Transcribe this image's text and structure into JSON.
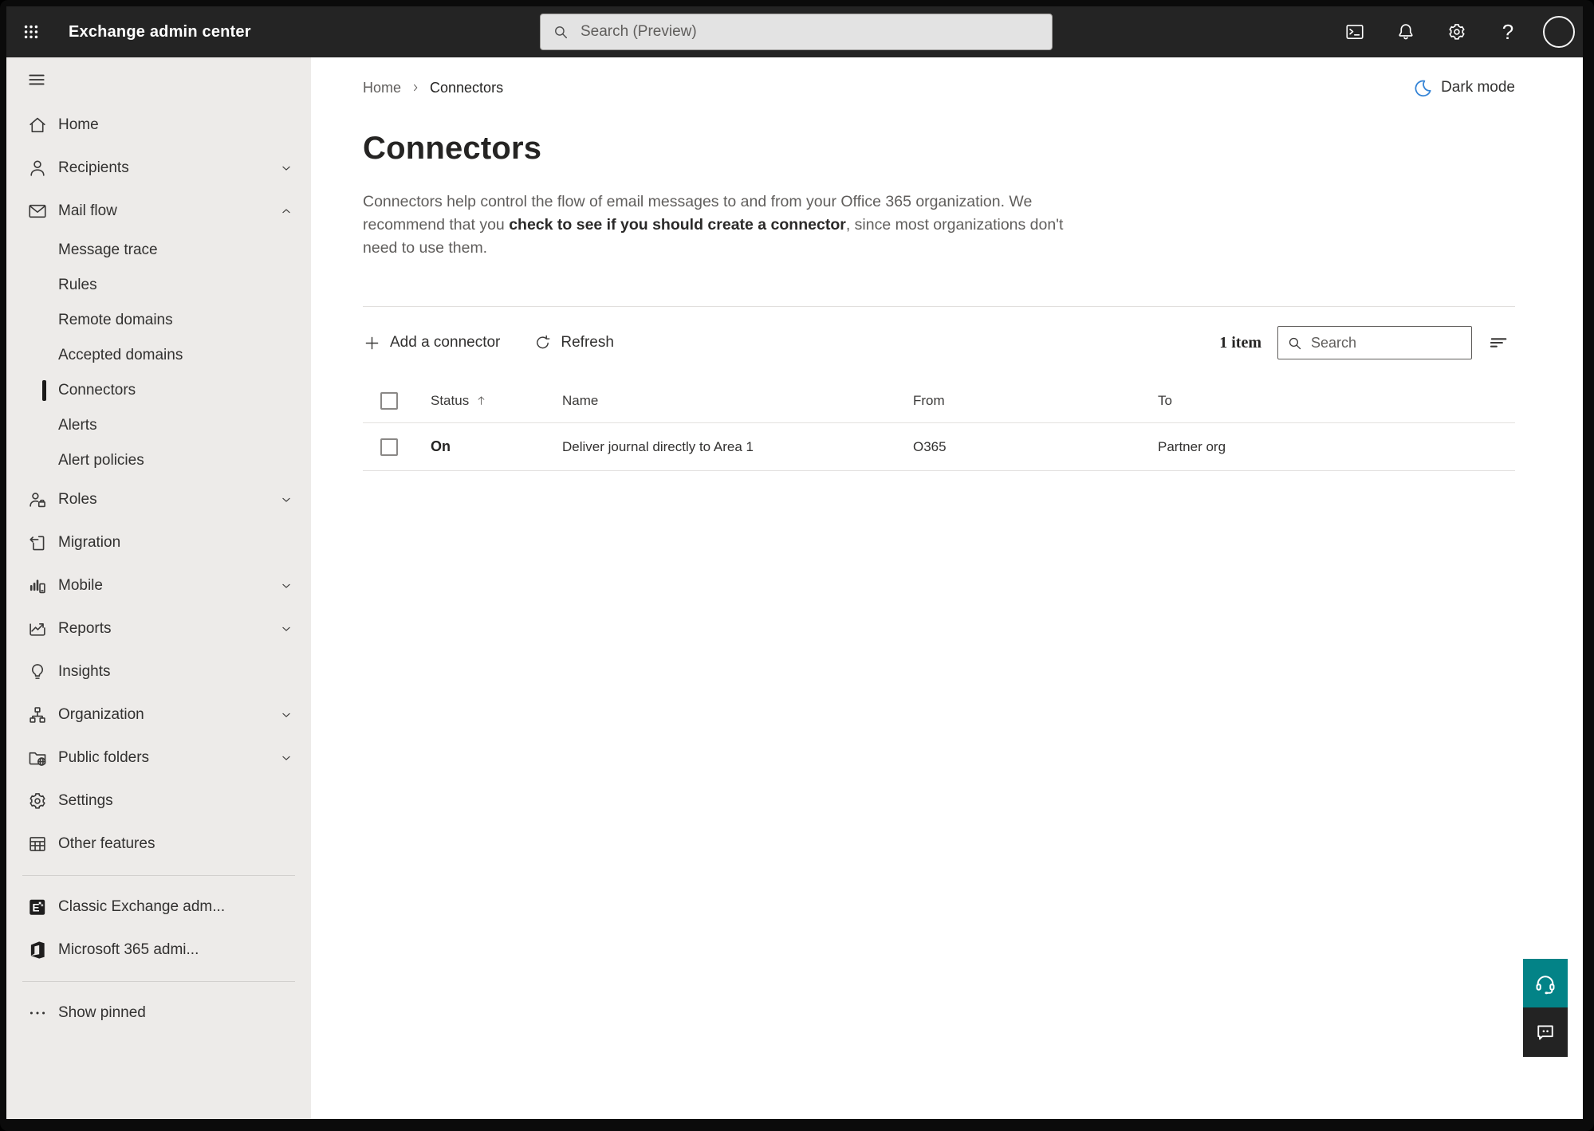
{
  "header": {
    "app_title": "Exchange admin center",
    "search_placeholder": "Search (Preview)",
    "icon_names": [
      "app-launcher-icon",
      "command-line-icon",
      "notifications-bell-icon",
      "gear-icon",
      "help-icon",
      "account-avatar"
    ]
  },
  "sidebar": {
    "items": [
      {
        "label": "Home",
        "icon": "home"
      },
      {
        "label": "Recipients",
        "icon": "person",
        "chevron": "down"
      },
      {
        "label": "Mail flow",
        "icon": "mail",
        "chevron": "up",
        "expanded": true
      },
      {
        "label": "Message trace",
        "sub": true
      },
      {
        "label": "Rules",
        "sub": true
      },
      {
        "label": "Remote domains",
        "sub": true
      },
      {
        "label": "Accepted domains",
        "sub": true
      },
      {
        "label": "Connectors",
        "sub": true,
        "selected": true
      },
      {
        "label": "Alerts",
        "sub": true
      },
      {
        "label": "Alert policies",
        "sub": true
      },
      {
        "label": "Roles",
        "icon": "roles",
        "chevron": "down"
      },
      {
        "label": "Migration",
        "icon": "migration"
      },
      {
        "label": "Mobile",
        "icon": "mobile",
        "chevron": "down"
      },
      {
        "label": "Reports",
        "icon": "reports",
        "chevron": "down"
      },
      {
        "label": "Insights",
        "icon": "lightbulb"
      },
      {
        "label": "Organization",
        "icon": "org-chart",
        "chevron": "down"
      },
      {
        "label": "Public folders",
        "icon": "folder-globe",
        "chevron": "down"
      },
      {
        "label": "Settings",
        "icon": "gear"
      },
      {
        "label": "Other features",
        "icon": "table-grid"
      }
    ],
    "external_items": [
      {
        "label": "Classic Exchange adm...",
        "icon": "exchange-logo"
      },
      {
        "label": "Microsoft 365 admi...",
        "icon": "office-logo"
      }
    ],
    "show_pinned_label": "Show pinned"
  },
  "breadcrumb": {
    "home": "Home",
    "current": "Connectors"
  },
  "dark_mode": {
    "label": "Dark mode"
  },
  "page": {
    "title": "Connectors",
    "description_prefix": "Connectors help control the flow of email messages to and from your Office 365 organization. We recommend that you ",
    "description_emphasis": "check to see if you should create a connector",
    "description_suffix": ", since most organizations don't need to use them."
  },
  "toolbar": {
    "add_connector_label": "Add a connector",
    "refresh_label": "Refresh",
    "item_count": "1 item",
    "search_placeholder": "Search"
  },
  "table": {
    "columns": {
      "status": "Status",
      "name": "Name",
      "from": "From",
      "to": "To"
    },
    "sort": {
      "column": "Status",
      "direction": "ascending"
    },
    "rows": [
      {
        "status": "On",
        "name": "Deliver journal directly to Area 1",
        "from": "O365",
        "to": "Partner org"
      }
    ]
  },
  "colors": {
    "topbar": "#242424",
    "sidebar_bg": "#edebe9",
    "accent_teal": "#038387",
    "feedback_dark": "#232323",
    "moon_blue": "#3584d6",
    "selected_indicator": "#1b1a19"
  }
}
